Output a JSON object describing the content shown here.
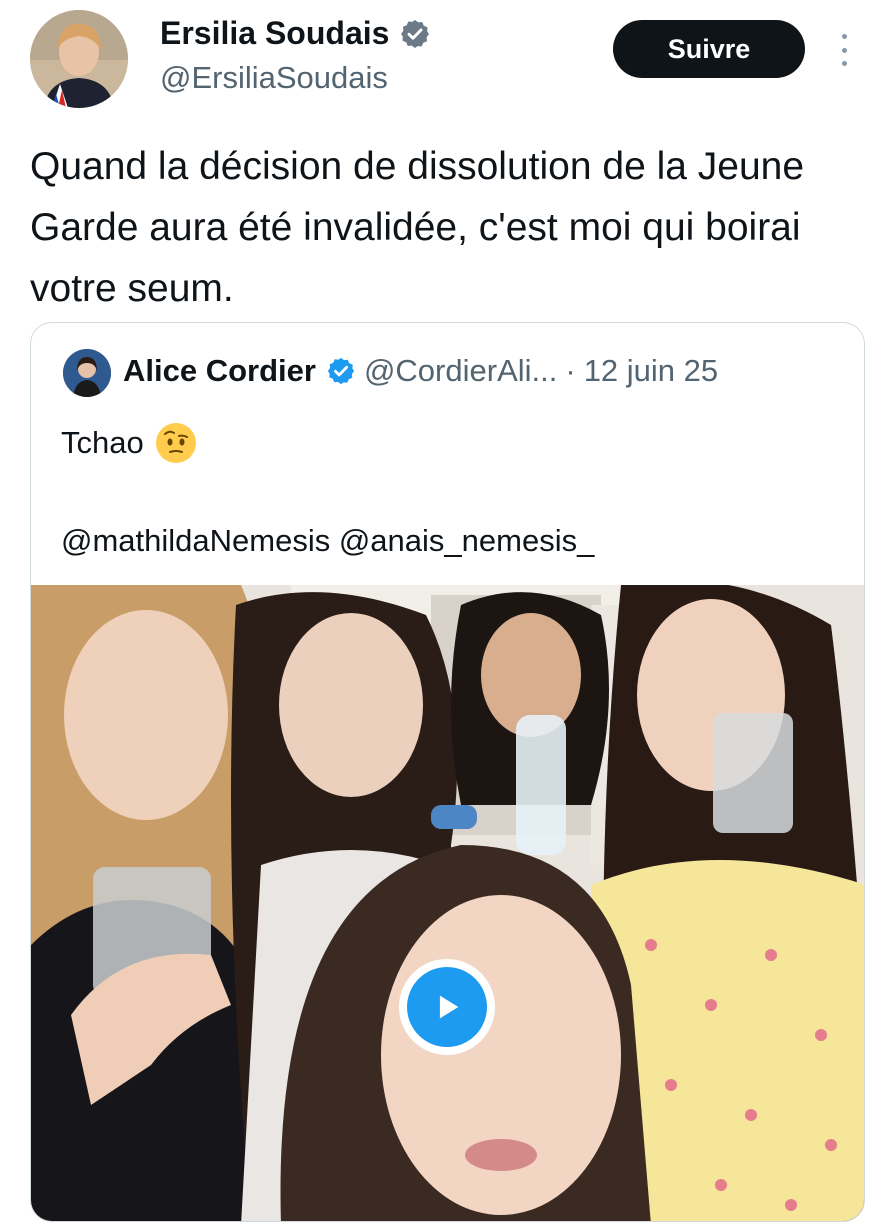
{
  "tweet": {
    "author": {
      "name": "Ersilia Soudais",
      "handle": "@ErsiliaSoudais",
      "verified_icon": "verified-badge-icon"
    },
    "follow_label": "Suivre",
    "more_icon": "more-vertical-icon",
    "text": "Quand la décision de dissolution de la Jeune Garde aura été invalidée, c'est moi qui boirai votre seum."
  },
  "quote": {
    "author": {
      "name": "Alice Cordier",
      "handle": "@CordierAli...",
      "verified_icon": "verified-badge-icon"
    },
    "separator": "·",
    "date": "12 juin 25",
    "text": "Tchao",
    "emoji_icon": "face-with-raised-eyebrow-emoji",
    "mentions": "@mathildaNemesis @anais_nemesis_",
    "media": {
      "type": "video",
      "play_icon": "play-icon"
    }
  },
  "colors": {
    "text": "#0f1419",
    "secondary": "#536471",
    "verified": "#1d9bf0",
    "follow_bg": "#0f1419",
    "border": "#cfd9de"
  }
}
